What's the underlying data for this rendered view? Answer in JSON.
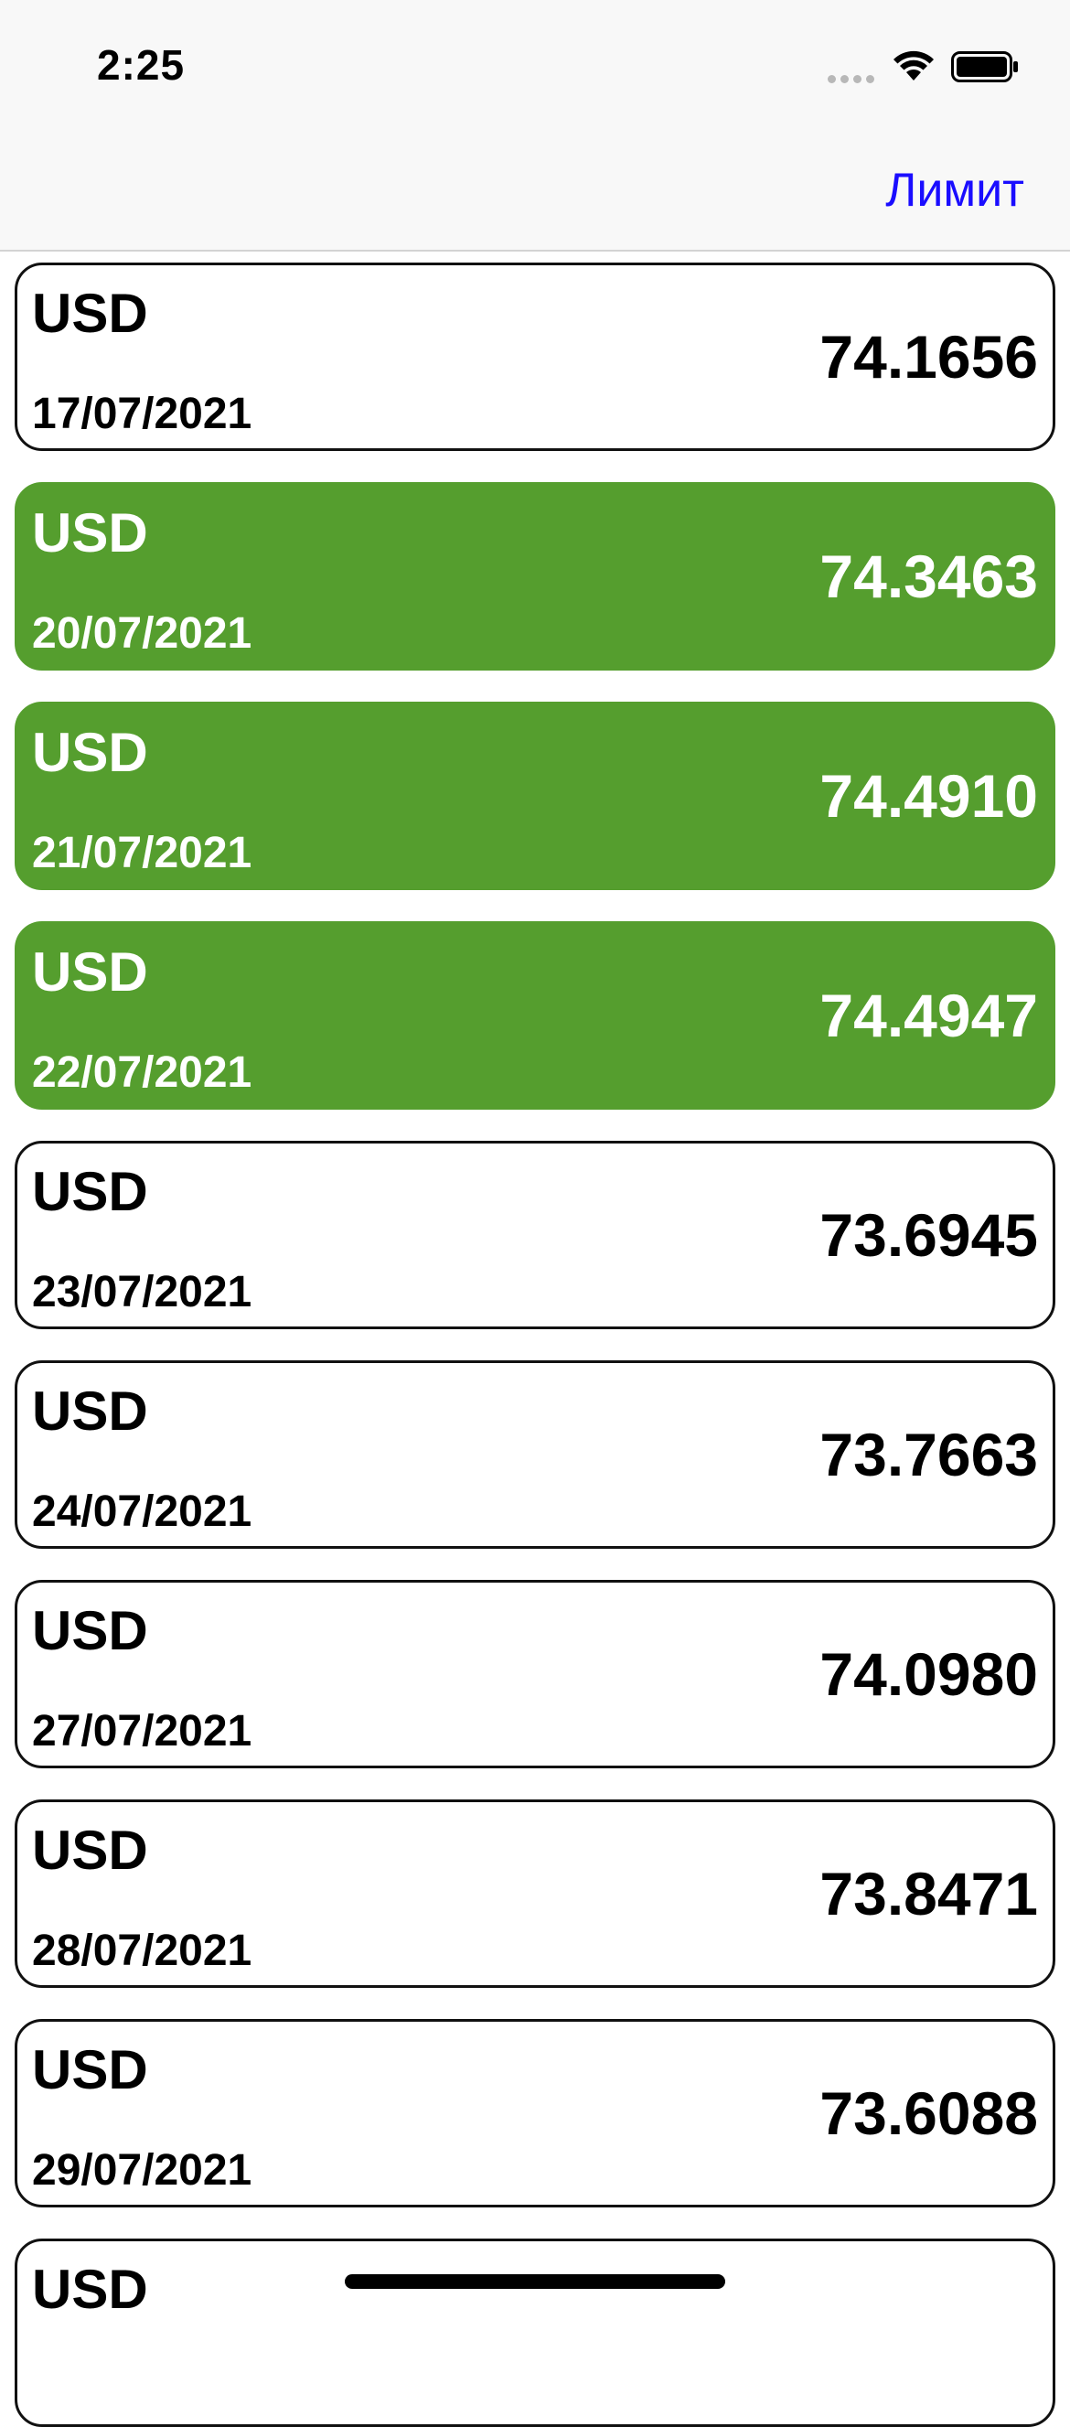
{
  "status_bar": {
    "time": "2:25"
  },
  "nav": {
    "limit_button": "Лимит",
    "accent_color": "#1a0dff"
  },
  "colors": {
    "highlight_green": "#559e2e",
    "card_border": "#111111"
  },
  "rates": [
    {
      "currency": "USD",
      "date": "17/07/2021",
      "rate": "74.1656",
      "highlighted": false
    },
    {
      "currency": "USD",
      "date": "20/07/2021",
      "rate": "74.3463",
      "highlighted": true
    },
    {
      "currency": "USD",
      "date": "21/07/2021",
      "rate": "74.4910",
      "highlighted": true
    },
    {
      "currency": "USD",
      "date": "22/07/2021",
      "rate": "74.4947",
      "highlighted": true
    },
    {
      "currency": "USD",
      "date": "23/07/2021",
      "rate": "73.6945",
      "highlighted": false
    },
    {
      "currency": "USD",
      "date": "24/07/2021",
      "rate": "73.7663",
      "highlighted": false
    },
    {
      "currency": "USD",
      "date": "27/07/2021",
      "rate": "74.0980",
      "highlighted": false
    },
    {
      "currency": "USD",
      "date": "28/07/2021",
      "rate": "73.8471",
      "highlighted": false
    },
    {
      "currency": "USD",
      "date": "29/07/2021",
      "rate": "73.6088",
      "highlighted": false
    },
    {
      "currency": "USD",
      "date": "",
      "rate": "",
      "highlighted": false
    }
  ]
}
